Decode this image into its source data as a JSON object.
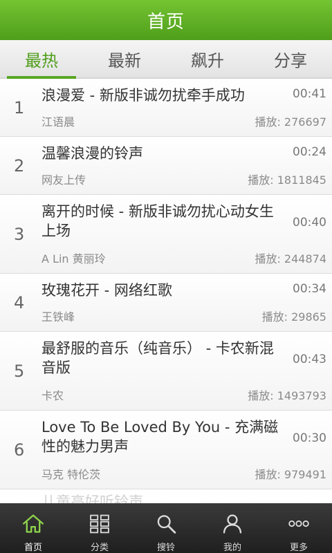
{
  "header": {
    "title": "首页"
  },
  "tabs": [
    {
      "label": "最热",
      "active": true
    },
    {
      "label": "最新",
      "active": false
    },
    {
      "label": "飙升",
      "active": false
    },
    {
      "label": "分享",
      "active": false
    }
  ],
  "songs": [
    {
      "index": "1",
      "title": "浪漫爱 - 新版非诚勿扰牵手成功",
      "duration": "00:41",
      "artist": "江语晨",
      "plays": "播放: 276697"
    },
    {
      "index": "2",
      "title": "温馨浪漫的铃声",
      "duration": "00:24",
      "artist": "网友上传",
      "plays": "播放: 1811845"
    },
    {
      "index": "3",
      "title": "离开的时候 - 新版非诚勿扰心动女生上场",
      "duration": "00:40",
      "artist": "A Lin 黄丽玲",
      "plays": "播放: 244874"
    },
    {
      "index": "4",
      "title": "玫瑰花开 - 网络红歌",
      "duration": "00:34",
      "artist": "王铁峰",
      "plays": "播放: 29865"
    },
    {
      "index": "5",
      "title": "最舒服的音乐（纯音乐） - 卡农新混音版",
      "duration": "00:43",
      "artist": "卡农",
      "plays": "播放: 1493793"
    },
    {
      "index": "6",
      "title": "Love To Be Loved By You - 充满磁性的魅力男声",
      "duration": "00:30",
      "artist": "马克 特伦茨",
      "plays": "播放: 979491"
    }
  ],
  "partial_row_text": "儿童高好听铃声",
  "nav": [
    {
      "label": "首页",
      "icon": "home-icon",
      "active": true
    },
    {
      "label": "分类",
      "icon": "grid-icon",
      "active": false
    },
    {
      "label": "搜铃",
      "icon": "search-icon",
      "active": false
    },
    {
      "label": "我的",
      "icon": "user-icon",
      "active": false
    },
    {
      "label": "更多",
      "icon": "more-icon",
      "active": false
    }
  ],
  "colors": {
    "brand_green": "#5aa624",
    "header_green": "#74c432",
    "nav_bg": "#2a2a2a"
  }
}
